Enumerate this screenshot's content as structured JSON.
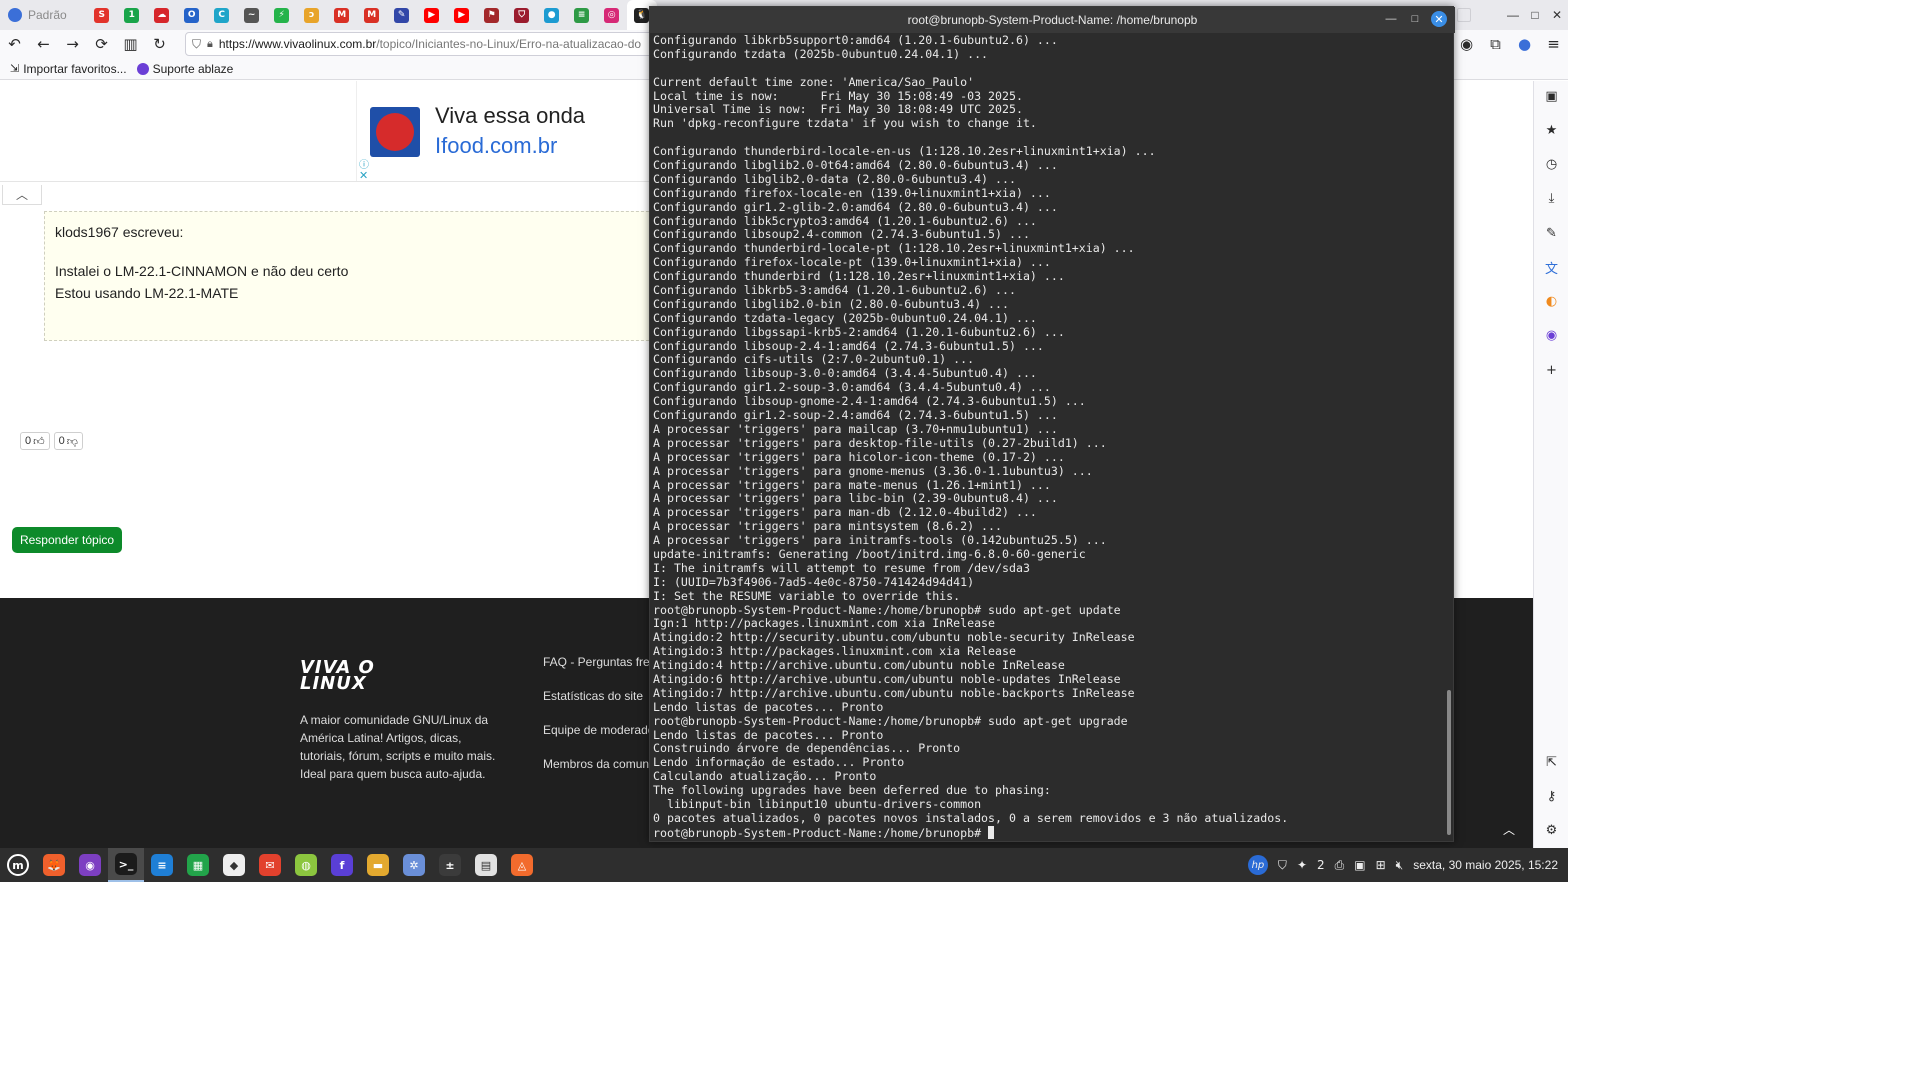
{
  "browser": {
    "profile_label": "Padrão",
    "url_host": "https://www.vivaolinux.com.br",
    "url_path": "/topico/Iniciantes-no-Linux/Erro-na-atualizacao-do",
    "bookmarks": [
      {
        "label": "Importar favoritos...",
        "icon": "import-icon"
      },
      {
        "label": "Suporte ablaze",
        "icon": "ablaze-icon"
      }
    ],
    "pinned_tabs": [
      {
        "icon": "red-square-icon",
        "color": "#e2332b",
        "glyph": "S"
      },
      {
        "icon": "green-circle-icon",
        "color": "#19a44a",
        "glyph": "1"
      },
      {
        "icon": "red-cloud-icon",
        "color": "#d6262b",
        "glyph": "☁"
      },
      {
        "icon": "blue-circle-icon",
        "color": "#2563c9",
        "glyph": "O"
      },
      {
        "icon": "teal-c-icon",
        "color": "#1fa5c9",
        "glyph": "C"
      },
      {
        "icon": "signature-icon",
        "color": "#555555",
        "glyph": "~"
      },
      {
        "icon": "green-bolt-icon",
        "color": "#25b34b",
        "glyph": "⚡"
      },
      {
        "icon": "swirl-icon",
        "color": "#e8a42a",
        "glyph": "ɔ"
      },
      {
        "icon": "gmail-icon",
        "color": "#d93025",
        "glyph": "M"
      },
      {
        "icon": "gmail-icon",
        "color": "#d93025",
        "glyph": "M"
      },
      {
        "icon": "pen-icon",
        "color": "#3247a8",
        "glyph": "✎"
      },
      {
        "icon": "youtube-icon",
        "color": "#ff0000",
        "glyph": "▶"
      },
      {
        "icon": "youtube-icon",
        "color": "#ff0000",
        "glyph": "▶"
      },
      {
        "icon": "bookmark-red-icon",
        "color": "#a3282b",
        "glyph": "⚑"
      },
      {
        "icon": "shield-red-icon",
        "color": "#9b1c2e",
        "glyph": "⛉"
      },
      {
        "icon": "circle-app-icon",
        "color": "#1d9bd1",
        "glyph": "●"
      },
      {
        "icon": "list-green-icon",
        "color": "#2e9a46",
        "glyph": "≡"
      },
      {
        "icon": "instagram-icon",
        "color": "#d62976",
        "glyph": "◎"
      },
      {
        "icon": "tux-icon",
        "color": "#222222",
        "glyph": "🐧"
      }
    ]
  },
  "page": {
    "ad": {
      "headline": "Viva essa onda",
      "sub": "Ifood.com.br",
      "info_icon": "info-icon",
      "close_icon": "close-icon"
    },
    "quote": {
      "author": "klods1967 escreveu:",
      "lines": [
        "Instalei o LM-22.1-CINNAMON e não deu certo",
        "Estou usando LM-22.1-MATE"
      ]
    },
    "votes": [
      {
        "count": "0",
        "icon": "thumbs-up-icon"
      },
      {
        "count": "0",
        "icon": "thumbs-down-icon"
      }
    ],
    "reply_button": "Responder tópico",
    "footer": {
      "logo_line1": "VIVA O",
      "logo_line2": "LINUX",
      "description": "A maior comunidade GNU/Linux da América Latina! Artigos, dicas, tutoriais, fórum, scripts e muito mais. Ideal para quem busca auto-ajuda.",
      "links": [
        "FAQ - Perguntas freq",
        "Estatísticas do site",
        "Equipe de moderado",
        "Membros da comunid"
      ]
    }
  },
  "terminal": {
    "title": "root@brunopb-System-Product-Name: /home/brunopb",
    "lines": [
      "Configurando libkrb5support0:amd64 (1.20.1-6ubuntu2.6) ...",
      "Configurando tzdata (2025b-0ubuntu0.24.04.1) ...",
      "",
      "Current default time zone: 'America/Sao_Paulo'",
      "Local time is now:      Fri May 30 15:08:49 -03 2025.",
      "Universal Time is now:  Fri May 30 18:08:49 UTC 2025.",
      "Run 'dpkg-reconfigure tzdata' if you wish to change it.",
      "",
      "Configurando thunderbird-locale-en-us (1:128.10.2esr+linuxmint1+xia) ...",
      "Configurando libglib2.0-0t64:amd64 (2.80.0-6ubuntu3.4) ...",
      "Configurando libglib2.0-data (2.80.0-6ubuntu3.4) ...",
      "Configurando firefox-locale-en (139.0+linuxmint1+xia) ...",
      "Configurando gir1.2-glib-2.0:amd64 (2.80.0-6ubuntu3.4) ...",
      "Configurando libk5crypto3:amd64 (1.20.1-6ubuntu2.6) ...",
      "Configurando libsoup2.4-common (2.74.3-6ubuntu1.5) ...",
      "Configurando thunderbird-locale-pt (1:128.10.2esr+linuxmint1+xia) ...",
      "Configurando firefox-locale-pt (139.0+linuxmint1+xia) ...",
      "Configurando thunderbird (1:128.10.2esr+linuxmint1+xia) ...",
      "Configurando libkrb5-3:amd64 (1.20.1-6ubuntu2.6) ...",
      "Configurando libglib2.0-bin (2.80.0-6ubuntu3.4) ...",
      "Configurando tzdata-legacy (2025b-0ubuntu0.24.04.1) ...",
      "Configurando libgssapi-krb5-2:amd64 (1.20.1-6ubuntu2.6) ...",
      "Configurando libsoup-2.4-1:amd64 (2.74.3-6ubuntu1.5) ...",
      "Configurando cifs-utils (2:7.0-2ubuntu0.1) ...",
      "Configurando libsoup-3.0-0:amd64 (3.4.4-5ubuntu0.4) ...",
      "Configurando gir1.2-soup-3.0:amd64 (3.4.4-5ubuntu0.4) ...",
      "Configurando libsoup-gnome-2.4-1:amd64 (2.74.3-6ubuntu1.5) ...",
      "Configurando gir1.2-soup-2.4:amd64 (2.74.3-6ubuntu1.5) ...",
      "A processar 'triggers' para mailcap (3.70+nmu1ubuntu1) ...",
      "A processar 'triggers' para desktop-file-utils (0.27-2build1) ...",
      "A processar 'triggers' para hicolor-icon-theme (0.17-2) ...",
      "A processar 'triggers' para gnome-menus (3.36.0-1.1ubuntu3) ...",
      "A processar 'triggers' para mate-menus (1.26.1+mint1) ...",
      "A processar 'triggers' para libc-bin (2.39-0ubuntu8.4) ...",
      "A processar 'triggers' para man-db (2.12.0-4build2) ...",
      "A processar 'triggers' para mintsystem (8.6.2) ...",
      "A processar 'triggers' para initramfs-tools (0.142ubuntu25.5) ...",
      "update-initramfs: Generating /boot/initrd.img-6.8.0-60-generic",
      "I: The initramfs will attempt to resume from /dev/sda3",
      "I: (UUID=7b3f4906-7ad5-4e0c-8750-741424d94d41)",
      "I: Set the RESUME variable to override this.",
      "root@brunopb-System-Product-Name:/home/brunopb# sudo apt-get update",
      "Ign:1 http://packages.linuxmint.com xia InRelease",
      "Atingido:2 http://security.ubuntu.com/ubuntu noble-security InRelease",
      "Atingido:3 http://packages.linuxmint.com xia Release",
      "Atingido:4 http://archive.ubuntu.com/ubuntu noble InRelease",
      "Atingido:6 http://archive.ubuntu.com/ubuntu noble-updates InRelease",
      "Atingido:7 http://archive.ubuntu.com/ubuntu noble-backports InRelease",
      "Lendo listas de pacotes... Pronto",
      "root@brunopb-System-Product-Name:/home/brunopb# sudo apt-get upgrade",
      "Lendo listas de pacotes... Pronto",
      "Construindo árvore de dependências... Pronto",
      "Lendo informação de estado... Pronto",
      "Calculando atualização... Pronto",
      "The following upgrades have been deferred due to phasing:",
      "  libinput-bin libinput10 ubuntu-drivers-common",
      "0 pacotes atualizados, 0 pacotes novos instalados, 0 a serem removidos e 3 não atualizados."
    ],
    "prompt": "root@brunopb-System-Product-Name:/home/brunopb# "
  },
  "taskbar": {
    "apps": [
      {
        "name": "mint-menu-icon",
        "color": "#2e2e2e",
        "glyph": "m"
      },
      {
        "name": "firefox-icon",
        "color": "#f0602c",
        "glyph": "🦊"
      },
      {
        "name": "tor-browser-icon",
        "color": "#7d3fc2",
        "glyph": "◉"
      },
      {
        "name": "terminal-icon",
        "color": "#1b1b1b",
        "glyph": ">_"
      },
      {
        "name": "writer-icon",
        "color": "#1f7fd6",
        "glyph": "≡"
      },
      {
        "name": "calc-icon",
        "color": "#22a44a",
        "glyph": "▦"
      },
      {
        "name": "inkscape-icon",
        "color": "#eeeeee",
        "glyph": "◆"
      },
      {
        "name": "mail-icon",
        "color": "#e2412d",
        "glyph": "✉"
      },
      {
        "name": "android-icon",
        "color": "#8cc63f",
        "glyph": "◍"
      },
      {
        "name": "fedora-icon",
        "color": "#5a3fd6",
        "glyph": "f"
      },
      {
        "name": "files-icon",
        "color": "#e3a92f",
        "glyph": "▬"
      },
      {
        "name": "network-icon",
        "color": "#6a8fd8",
        "glyph": "✲"
      },
      {
        "name": "calculator-icon",
        "color": "#3b3b3b",
        "glyph": "±"
      },
      {
        "name": "archive-icon",
        "color": "#e2e2e2",
        "glyph": "▤"
      },
      {
        "name": "brave-icon",
        "color": "#f26b2d",
        "glyph": "◬"
      }
    ],
    "tray": {
      "hp_icon": "hp-icon",
      "notifications_count": "2",
      "clock": "sexta, 30 maio 2025, 15:22"
    }
  },
  "colors": {
    "terminal_bg": "#2c2c2c",
    "footer_bg": "#1f1f1f",
    "reply_button": "#0d8a2a",
    "taskbar_bg": "#2e2e2e",
    "link_blue": "#2a6bd6"
  }
}
